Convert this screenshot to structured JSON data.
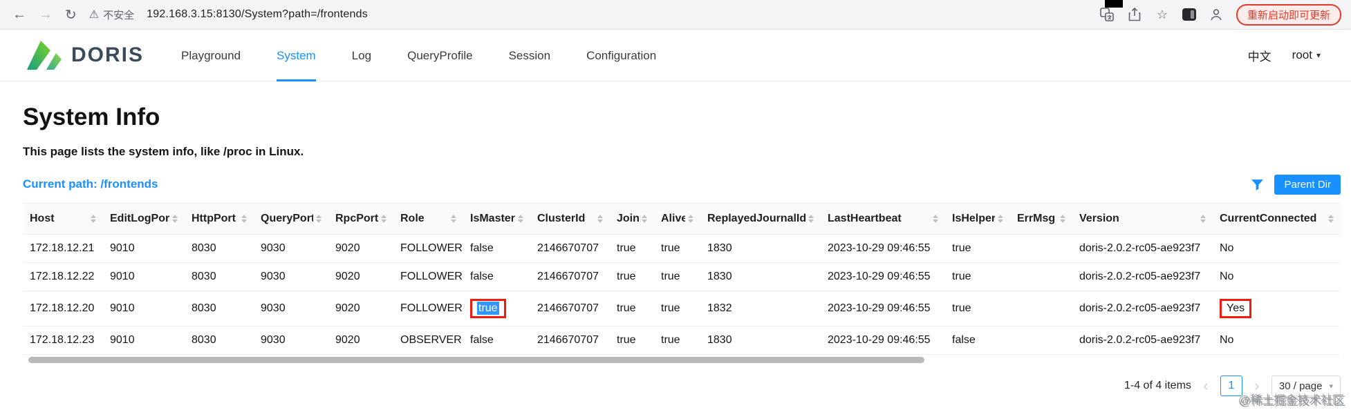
{
  "browser": {
    "url": "192.168.3.15:8130/System?path=/frontends",
    "security_label": "不安全",
    "restart_button": "重新启动即可更新"
  },
  "icons": {
    "back": "←",
    "forward": "→",
    "refresh": "↻",
    "warning": "⚠",
    "star": "☆",
    "caret_down": "▾",
    "prev": "‹",
    "next": "›"
  },
  "nav": {
    "brand": "DORIS",
    "items": [
      {
        "label": "Playground",
        "active": false
      },
      {
        "label": "System",
        "active": true
      },
      {
        "label": "Log",
        "active": false
      },
      {
        "label": "QueryProfile",
        "active": false
      },
      {
        "label": "Session",
        "active": false
      },
      {
        "label": "Configuration",
        "active": false
      }
    ],
    "lang": "中文",
    "user": "root"
  },
  "page": {
    "title": "System Info",
    "subtitle": "This page lists the system info, like /proc in Linux.",
    "current_path": "Current path: /frontends",
    "parent_dir_label": "Parent Dir"
  },
  "table": {
    "columns": [
      "Host",
      "EditLogPort",
      "HttpPort",
      "QueryPort",
      "RpcPort",
      "Role",
      "IsMaster",
      "ClusterId",
      "Join",
      "Alive",
      "ReplayedJournalId",
      "LastHeartbeat",
      "IsHelper",
      "ErrMsg",
      "Version",
      "CurrentConnected"
    ],
    "rows": [
      [
        "172.18.12.21",
        "9010",
        "8030",
        "9030",
        "9020",
        "FOLLOWER",
        "false",
        "2146670707",
        "true",
        "true",
        "1830",
        "2023-10-29 09:46:55",
        "true",
        "",
        "doris-2.0.2-rc05-ae923f7",
        "No"
      ],
      [
        "172.18.12.22",
        "9010",
        "8030",
        "9030",
        "9020",
        "FOLLOWER",
        "false",
        "2146670707",
        "true",
        "true",
        "1830",
        "2023-10-29 09:46:55",
        "true",
        "",
        "doris-2.0.2-rc05-ae923f7",
        "No"
      ],
      [
        "172.18.12.20",
        "9010",
        "8030",
        "9030",
        "9020",
        "FOLLOWER",
        "true",
        "2146670707",
        "true",
        "true",
        "1832",
        "2023-10-29 09:46:55",
        "true",
        "",
        "doris-2.0.2-rc05-ae923f7",
        "Yes"
      ],
      [
        "172.18.12.23",
        "9010",
        "8030",
        "9030",
        "9020",
        "OBSERVER",
        "false",
        "2146670707",
        "true",
        "true",
        "1830",
        "2023-10-29 09:46:55",
        "false",
        "",
        "doris-2.0.2-rc05-ae923f7",
        "No"
      ]
    ],
    "highlights": [
      {
        "row": 2,
        "col": 6,
        "selected": true
      },
      {
        "row": 2,
        "col": 15,
        "selected": false
      }
    ]
  },
  "pagination": {
    "summary": "1-4 of 4 items",
    "current_page": "1",
    "page_size": "30 / page"
  },
  "watermark": "@稀土掘金技术社区",
  "colors": {
    "accent_blue": "#1890ff",
    "highlight_red": "#f5190a",
    "selection_blue": "#3297fd",
    "restart_red": "#e5392b"
  }
}
